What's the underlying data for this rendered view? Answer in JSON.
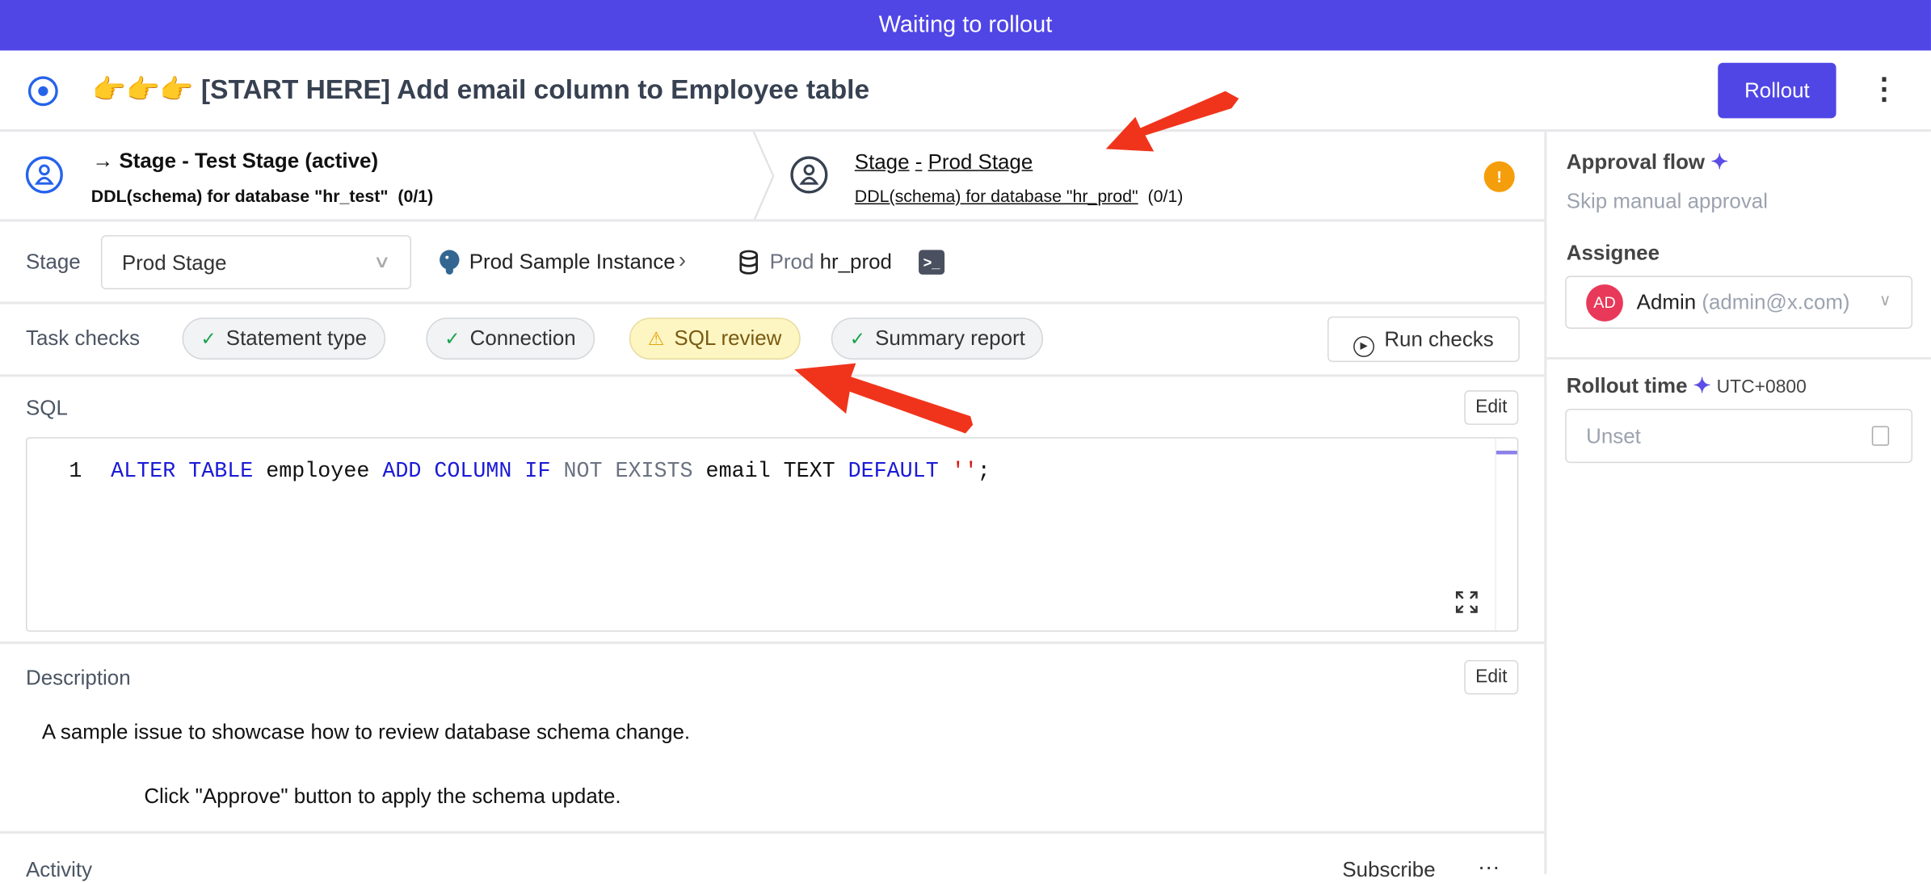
{
  "banner": "Waiting to rollout",
  "header": {
    "title_emoji": "👉👉👉",
    "title": "[START HERE] Add email column to Employee table",
    "rollout_label": "Rollout"
  },
  "stages": [
    {
      "arrow": "→",
      "title": "Stage - Test Stage (active)",
      "subtitle": "DDL(schema) for database \"hr_test\"",
      "count": "(0/1)"
    },
    {
      "title_a": "Stage",
      "title_sep": "-",
      "title_b": "Prod Stage",
      "subtitle": "DDL(schema) for database \"hr_prod\"",
      "count": "(0/1)",
      "badge": "!"
    }
  ],
  "target": {
    "stage_label": "Stage",
    "stage_value": "Prod Stage",
    "instance": "Prod Sample Instance",
    "env": "Prod",
    "database": "hr_prod"
  },
  "task_checks": {
    "label": "Task checks",
    "items": [
      {
        "label": "Statement type",
        "status": "success"
      },
      {
        "label": "Connection",
        "status": "success"
      },
      {
        "label": "SQL review",
        "status": "warning"
      },
      {
        "label": "Summary report",
        "status": "success"
      }
    ],
    "run_label": "Run checks"
  },
  "sql": {
    "label": "SQL",
    "edit_label": "Edit",
    "line_number": "1",
    "tokens": [
      {
        "t": "ALTER TABLE",
        "c": "kw"
      },
      {
        "t": " employee ",
        "c": ""
      },
      {
        "t": "ADD COLUMN IF",
        "c": "kw"
      },
      {
        "t": " NOT EXISTS",
        "c": "dim"
      },
      {
        "t": " email TEXT ",
        "c": ""
      },
      {
        "t": "DEFAULT",
        "c": "kw"
      },
      {
        "t": " ''",
        "c": "str"
      },
      {
        "t": ";",
        "c": ""
      }
    ]
  },
  "description": {
    "label": "Description",
    "edit_label": "Edit",
    "line1": "A sample issue to showcase how to review database schema change.",
    "line2": "Click \"Approve\" button to apply the schema update."
  },
  "activity": {
    "label": "Activity",
    "subscribe_label": "Subscribe"
  },
  "sidebar": {
    "approval_label": "Approval flow",
    "approval_value": "Skip manual approval",
    "assignee_label": "Assignee",
    "assignee_initials": "AD",
    "assignee_name": "Admin",
    "assignee_email": "(admin@x.com)",
    "rollout_time_label": "Rollout time",
    "timezone": "UTC+0800",
    "rollout_placeholder": "Unset"
  },
  "colors": {
    "primary": "#5046e5",
    "arrow": "#f0341c",
    "warning": "#f59e0b",
    "avatar": "#e8395a"
  }
}
